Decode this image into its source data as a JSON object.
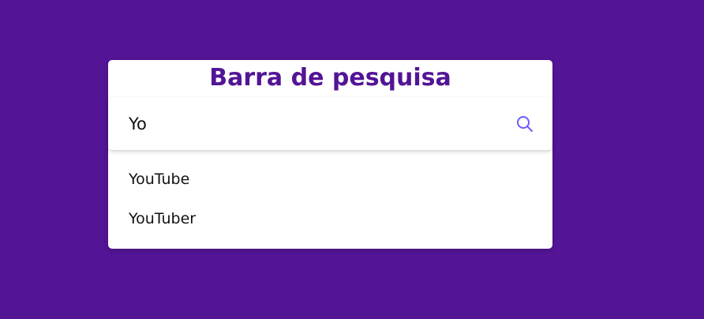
{
  "page": {
    "title": "Barra de pesquisa"
  },
  "search": {
    "value": "Yo",
    "icon": "search-icon"
  },
  "suggestions": [
    {
      "label": "YouTube"
    },
    {
      "label": "YouTuber"
    }
  ],
  "colors": {
    "background": "#531495",
    "title": "#531495",
    "icon": "#6a5cff",
    "card": "#ffffff"
  }
}
